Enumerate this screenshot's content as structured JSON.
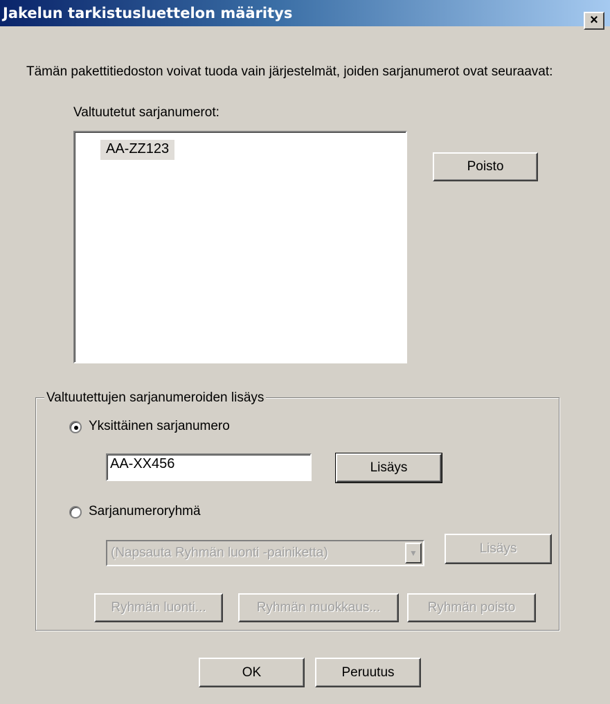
{
  "window": {
    "title": "Jakelun tarkistusluettelon määritys",
    "close_glyph": "×"
  },
  "description": "Tämän pakettitiedoston voivat tuoda vain järjestelmät, joiden sarjanumerot ovat seuraavat:",
  "authorized_list": {
    "label": "Valtuutetut sarjanumerot:",
    "items": [
      "AA-ZZ123"
    ],
    "remove_button": "Poisto"
  },
  "add_group": {
    "legend": "Valtuutettujen sarjanumeroiden lisäys",
    "single": {
      "label": "Yksittäinen sarjanumero",
      "selected": true,
      "input_value": "AA-XX456",
      "add_button": "Lisäys"
    },
    "range": {
      "label": "Sarjanumeroryhmä",
      "selected": false,
      "combo_value": "(Napsauta Ryhmän luonti -painiketta)",
      "add_button": "Lisäys",
      "create_button": "Ryhmän luonti...",
      "edit_button": "Ryhmän muokkaus...",
      "delete_button": "Ryhmän poisto"
    }
  },
  "footer": {
    "ok_button": "OK",
    "cancel_button": "Peruutus"
  },
  "colors": {
    "dialog_bg": "#d4d0c8",
    "titlebar_start": "#0a246a",
    "titlebar_end": "#a6caf0",
    "disabled_text": "#a0a0a0"
  },
  "icons": {
    "close": "close-icon",
    "combo_arrow": "chevron-down-icon",
    "radio": "radio-icon"
  }
}
